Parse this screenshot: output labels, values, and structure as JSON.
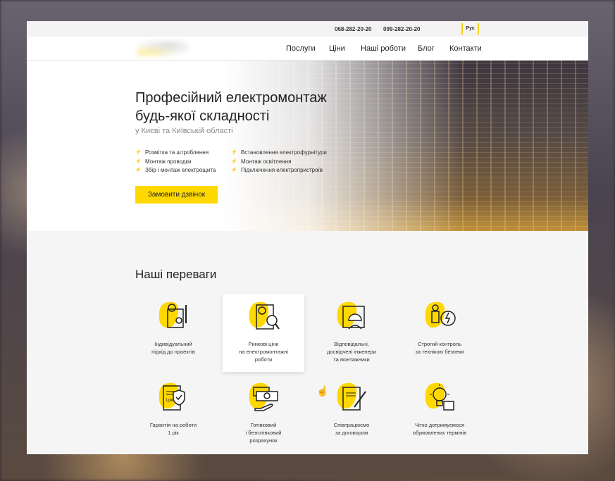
{
  "topbar": {
    "phone1": "068-282-20-20",
    "phone2": "099-282-20-20",
    "lang": "Рус"
  },
  "nav": {
    "items": [
      "Послуги",
      "Ціни",
      "Наші роботи",
      "Блог",
      "Контакти"
    ]
  },
  "hero": {
    "title": "Професійний електромонтаж будь-якої складності",
    "subtitle": "у Києві та Київській області",
    "features_left": [
      "Розмітка та штроблення",
      "Монтаж проводки",
      "Збір і монтаж електрощита"
    ],
    "features_right": [
      "Встановлення електрофурнітури",
      "Монтаж освітлення",
      "Підключення електропристроїв"
    ],
    "cta": "Замовити дзвінок"
  },
  "advantages": {
    "title": "Наші переваги",
    "accent": "#ffd800",
    "items": [
      {
        "icon": "blueprint-idea-icon",
        "lines": [
          "Індивідуальний",
          "підхід до проектів"
        ]
      },
      {
        "icon": "price-search-icon",
        "lines": [
          "Ринкові ціни",
          "на електромонтажні",
          "роботи"
        ]
      },
      {
        "icon": "engineer-icon",
        "lines": [
          "Відповідальні,",
          "досвідчені інженери",
          "та монтажники"
        ]
      },
      {
        "icon": "safety-control-icon",
        "lines": [
          "Строгий контроль",
          "за технікою безпеки"
        ]
      },
      {
        "icon": "warranty-shield-icon",
        "lines": [
          "Гарантія на роботи",
          "1 рік"
        ],
        "badge": "1рік"
      },
      {
        "icon": "cash-payment-icon",
        "lines": [
          "Готівковий",
          "і безготівковий",
          "розрахунок"
        ]
      },
      {
        "icon": "contract-icon",
        "lines": [
          "Співпрацюємо",
          "за договором"
        ]
      },
      {
        "icon": "deadline-bulb-icon",
        "lines": [
          "Чітко дотримуємося",
          "обумовлених термінів"
        ]
      }
    ]
  }
}
